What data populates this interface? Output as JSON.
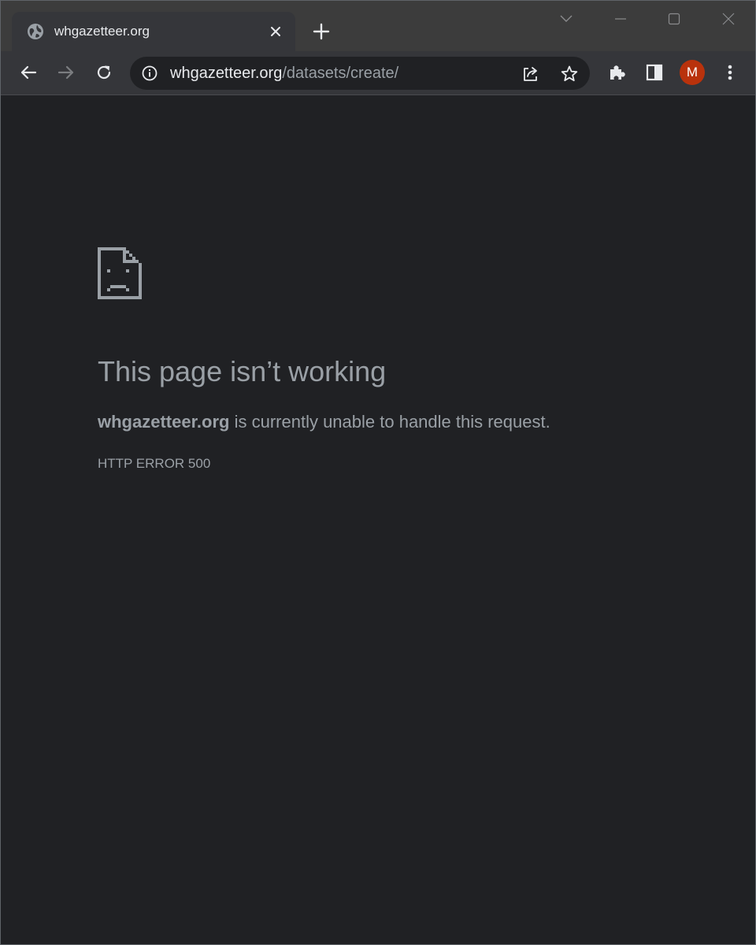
{
  "tab": {
    "title": "whgazetteer.org",
    "favicon_icon": "globe-icon",
    "close_icon": "close-icon"
  },
  "toolbar": {
    "url_host": "whgazetteer.org",
    "url_path": "/datasets/create/",
    "profile_initial": "M",
    "profile_color": "#b9320c",
    "icons": [
      "back-arrow-icon",
      "forward-arrow-icon",
      "reload-icon",
      "info-icon",
      "share-icon",
      "star-icon",
      "extensions-icon",
      "side-panel-icon",
      "more-vert-icon"
    ]
  },
  "window_controls": [
    "chevron-down-icon",
    "minimize-icon",
    "maximize-icon",
    "close-icon"
  ],
  "error": {
    "icon": "sad-page-icon",
    "heading": "This page isn’t working",
    "host": "whgazetteer.org",
    "message": " is currently unable to handle this request.",
    "code": "HTTP ERROR 500"
  },
  "colors": {
    "page_background": "#202124",
    "chrome_frame": "#3c3c3c",
    "toolbar": "#35363a",
    "text_muted": "#9aa0a6"
  }
}
